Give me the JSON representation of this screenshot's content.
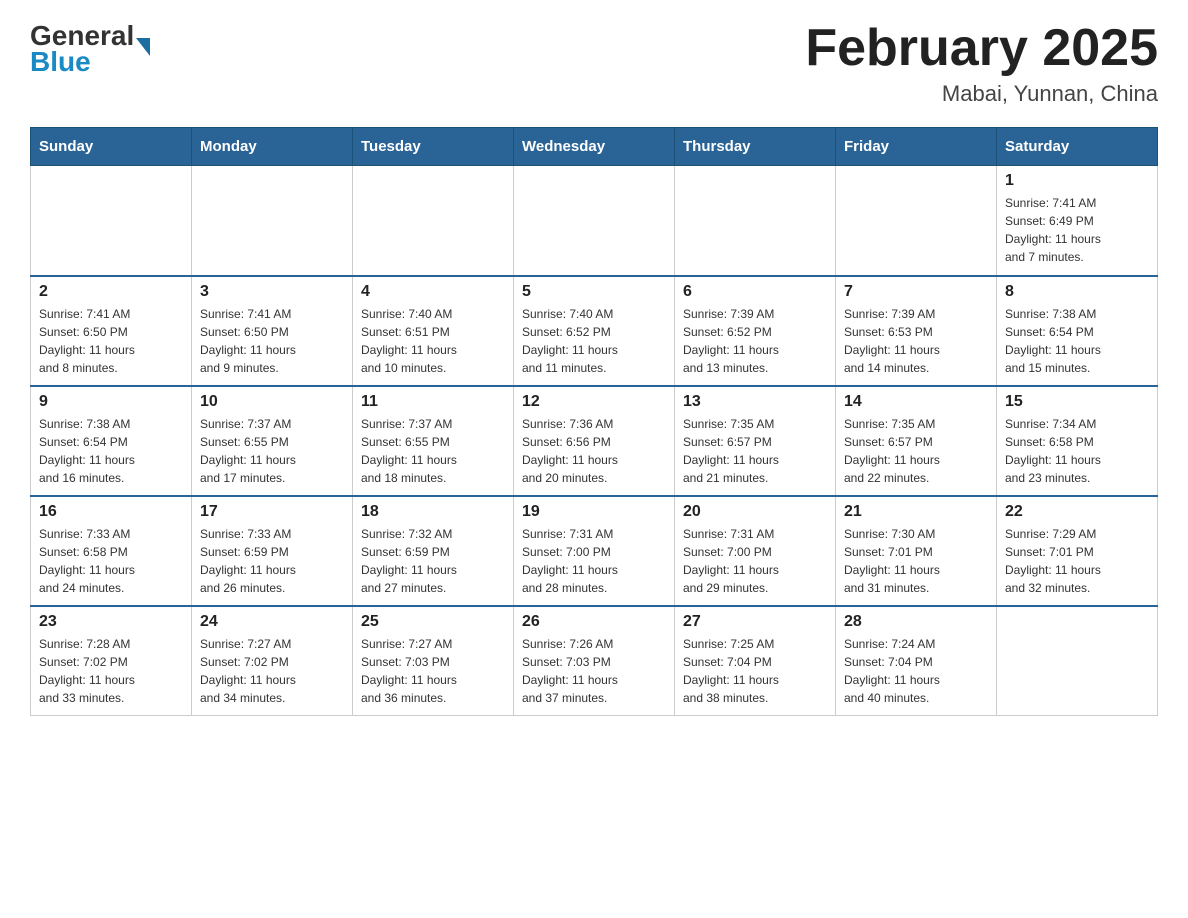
{
  "header": {
    "logo_general": "General",
    "logo_blue": "Blue",
    "month_title": "February 2025",
    "location": "Mabai, Yunnan, China"
  },
  "weekdays": [
    "Sunday",
    "Monday",
    "Tuesday",
    "Wednesday",
    "Thursday",
    "Friday",
    "Saturday"
  ],
  "weeks": [
    [
      {
        "day": "",
        "info": ""
      },
      {
        "day": "",
        "info": ""
      },
      {
        "day": "",
        "info": ""
      },
      {
        "day": "",
        "info": ""
      },
      {
        "day": "",
        "info": ""
      },
      {
        "day": "",
        "info": ""
      },
      {
        "day": "1",
        "info": "Sunrise: 7:41 AM\nSunset: 6:49 PM\nDaylight: 11 hours\nand 7 minutes."
      }
    ],
    [
      {
        "day": "2",
        "info": "Sunrise: 7:41 AM\nSunset: 6:50 PM\nDaylight: 11 hours\nand 8 minutes."
      },
      {
        "day": "3",
        "info": "Sunrise: 7:41 AM\nSunset: 6:50 PM\nDaylight: 11 hours\nand 9 minutes."
      },
      {
        "day": "4",
        "info": "Sunrise: 7:40 AM\nSunset: 6:51 PM\nDaylight: 11 hours\nand 10 minutes."
      },
      {
        "day": "5",
        "info": "Sunrise: 7:40 AM\nSunset: 6:52 PM\nDaylight: 11 hours\nand 11 minutes."
      },
      {
        "day": "6",
        "info": "Sunrise: 7:39 AM\nSunset: 6:52 PM\nDaylight: 11 hours\nand 13 minutes."
      },
      {
        "day": "7",
        "info": "Sunrise: 7:39 AM\nSunset: 6:53 PM\nDaylight: 11 hours\nand 14 minutes."
      },
      {
        "day": "8",
        "info": "Sunrise: 7:38 AM\nSunset: 6:54 PM\nDaylight: 11 hours\nand 15 minutes."
      }
    ],
    [
      {
        "day": "9",
        "info": "Sunrise: 7:38 AM\nSunset: 6:54 PM\nDaylight: 11 hours\nand 16 minutes."
      },
      {
        "day": "10",
        "info": "Sunrise: 7:37 AM\nSunset: 6:55 PM\nDaylight: 11 hours\nand 17 minutes."
      },
      {
        "day": "11",
        "info": "Sunrise: 7:37 AM\nSunset: 6:55 PM\nDaylight: 11 hours\nand 18 minutes."
      },
      {
        "day": "12",
        "info": "Sunrise: 7:36 AM\nSunset: 6:56 PM\nDaylight: 11 hours\nand 20 minutes."
      },
      {
        "day": "13",
        "info": "Sunrise: 7:35 AM\nSunset: 6:57 PM\nDaylight: 11 hours\nand 21 minutes."
      },
      {
        "day": "14",
        "info": "Sunrise: 7:35 AM\nSunset: 6:57 PM\nDaylight: 11 hours\nand 22 minutes."
      },
      {
        "day": "15",
        "info": "Sunrise: 7:34 AM\nSunset: 6:58 PM\nDaylight: 11 hours\nand 23 minutes."
      }
    ],
    [
      {
        "day": "16",
        "info": "Sunrise: 7:33 AM\nSunset: 6:58 PM\nDaylight: 11 hours\nand 24 minutes."
      },
      {
        "day": "17",
        "info": "Sunrise: 7:33 AM\nSunset: 6:59 PM\nDaylight: 11 hours\nand 26 minutes."
      },
      {
        "day": "18",
        "info": "Sunrise: 7:32 AM\nSunset: 6:59 PM\nDaylight: 11 hours\nand 27 minutes."
      },
      {
        "day": "19",
        "info": "Sunrise: 7:31 AM\nSunset: 7:00 PM\nDaylight: 11 hours\nand 28 minutes."
      },
      {
        "day": "20",
        "info": "Sunrise: 7:31 AM\nSunset: 7:00 PM\nDaylight: 11 hours\nand 29 minutes."
      },
      {
        "day": "21",
        "info": "Sunrise: 7:30 AM\nSunset: 7:01 PM\nDaylight: 11 hours\nand 31 minutes."
      },
      {
        "day": "22",
        "info": "Sunrise: 7:29 AM\nSunset: 7:01 PM\nDaylight: 11 hours\nand 32 minutes."
      }
    ],
    [
      {
        "day": "23",
        "info": "Sunrise: 7:28 AM\nSunset: 7:02 PM\nDaylight: 11 hours\nand 33 minutes."
      },
      {
        "day": "24",
        "info": "Sunrise: 7:27 AM\nSunset: 7:02 PM\nDaylight: 11 hours\nand 34 minutes."
      },
      {
        "day": "25",
        "info": "Sunrise: 7:27 AM\nSunset: 7:03 PM\nDaylight: 11 hours\nand 36 minutes."
      },
      {
        "day": "26",
        "info": "Sunrise: 7:26 AM\nSunset: 7:03 PM\nDaylight: 11 hours\nand 37 minutes."
      },
      {
        "day": "27",
        "info": "Sunrise: 7:25 AM\nSunset: 7:04 PM\nDaylight: 11 hours\nand 38 minutes."
      },
      {
        "day": "28",
        "info": "Sunrise: 7:24 AM\nSunset: 7:04 PM\nDaylight: 11 hours\nand 40 minutes."
      },
      {
        "day": "",
        "info": ""
      }
    ]
  ]
}
